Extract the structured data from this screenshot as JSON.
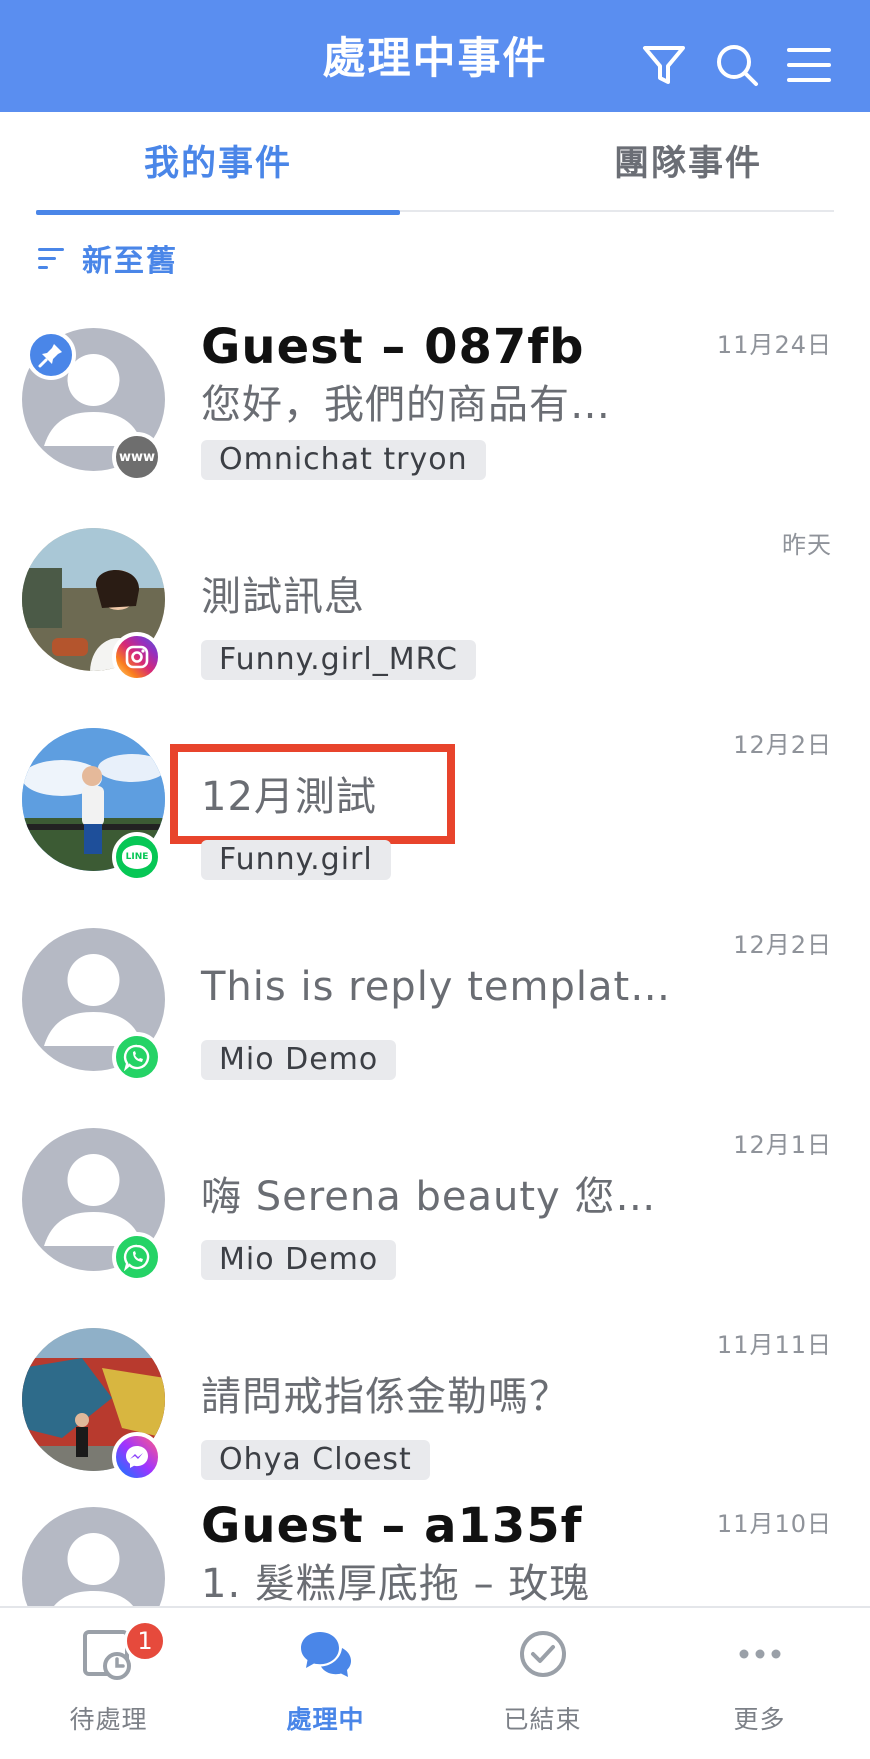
{
  "header": {
    "title": "處理中事件",
    "filter_icon": "filter-icon",
    "search_icon": "search-icon",
    "menu_icon": "menu-icon"
  },
  "tabs": [
    {
      "label": "我的事件",
      "active": true
    },
    {
      "label": "團隊事件",
      "active": false
    }
  ],
  "sort": {
    "label": "新至舊",
    "icon": "sort-icon"
  },
  "conversations": [
    {
      "name": "Guest – 087fb",
      "message": "您好，我們的商品有…",
      "tag": "Omnichat tryon",
      "time": "11月24日",
      "channel": "web",
      "channel_label": "www",
      "pinned": true,
      "avatar": "default"
    },
    {
      "name": "",
      "message": "測試訊息",
      "tag": "Funny.girl_MRC",
      "time": "昨天",
      "channel": "instagram",
      "avatar": "photo"
    },
    {
      "name": "",
      "message": "12月測試",
      "tag": "Funny.girl",
      "time": "12月2日",
      "channel": "line",
      "channel_label": "LINE",
      "avatar": "photo",
      "highlighted": true
    },
    {
      "name": "",
      "message": "This is reply templat…",
      "tag": "Mio Demo",
      "time": "12月2日",
      "channel": "whatsapp",
      "avatar": "default"
    },
    {
      "name": "",
      "message": "嗨 Serena beauty 您…",
      "tag": "Mio Demo",
      "time": "12月1日",
      "channel": "whatsapp",
      "avatar": "default"
    },
    {
      "name": "",
      "message": "請問戒指係金勒嗎？",
      "tag": "Ohya Cloest",
      "time": "11月11日",
      "channel": "messenger",
      "avatar": "photo"
    },
    {
      "name": "Guest – a135f",
      "message": "1. 髮糕厚底拖 – 玫瑰",
      "tag": "",
      "time": "11月10日",
      "channel": "web",
      "avatar": "default"
    }
  ],
  "bottom_nav": [
    {
      "label": "待處理",
      "icon": "pending-clock-icon",
      "badge": "1",
      "active": false
    },
    {
      "label": "處理中",
      "icon": "chat-bubbles-icon",
      "active": true
    },
    {
      "label": "已結束",
      "icon": "check-circle-icon",
      "active": false
    },
    {
      "label": "更多",
      "icon": "more-dots-icon",
      "active": false
    }
  ],
  "colors": {
    "header": "#5a8ef0",
    "accent": "#4a86e8",
    "highlight": "#e8442c",
    "line": "#06c755",
    "whatsapp": "#25d366",
    "instagram": "#d62976",
    "messenger": "#8a3ffc"
  }
}
